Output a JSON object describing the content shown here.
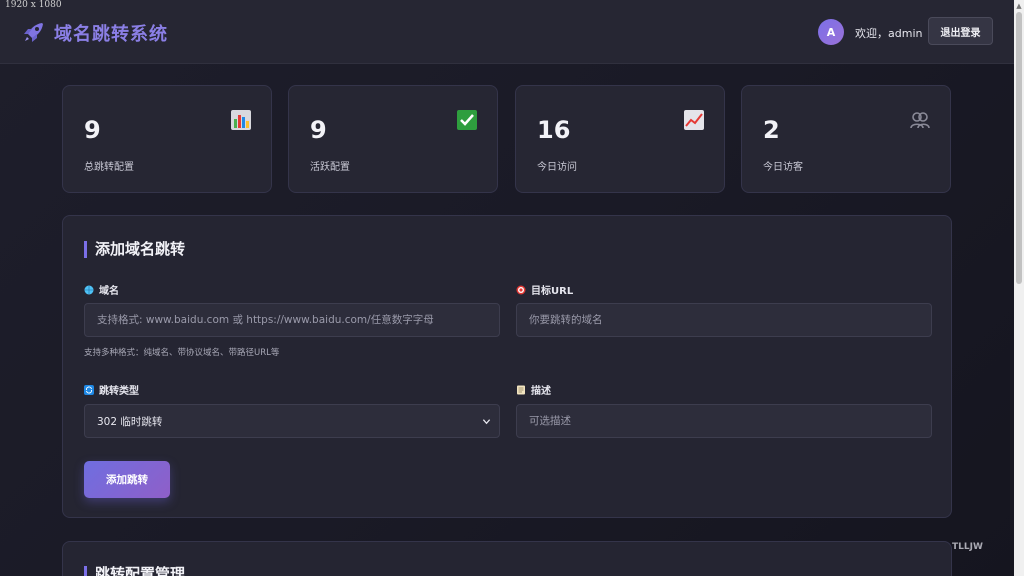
{
  "screen_label": "1920 x 1080",
  "header": {
    "brand": "域名跳转系统",
    "avatar_letter": "A",
    "welcome": "欢迎，admin",
    "logout_label": "退出登录"
  },
  "stats": [
    {
      "value": "9",
      "label": "总跳转配置",
      "icon": "bar-chart-icon"
    },
    {
      "value": "9",
      "label": "活跃配置",
      "icon": "check-mark-icon"
    },
    {
      "value": "16",
      "label": "今日访问",
      "icon": "trend-up-icon"
    },
    {
      "value": "2",
      "label": "今日访客",
      "icon": "users-icon"
    }
  ],
  "form": {
    "title": "添加域名跳转",
    "domain": {
      "label": "域名",
      "placeholder": "支持格式: www.baidu.com 或 https://www.baidu.com/任意数字字母",
      "hint": "支持多种格式：纯域名、带协议域名、带路径URL等"
    },
    "target": {
      "label": "目标URL",
      "placeholder": "你要跳转的域名"
    },
    "redirect_type": {
      "label": "跳转类型",
      "selected": "302 临时跳转"
    },
    "description": {
      "label": "描述",
      "placeholder": "可选描述"
    },
    "submit_label": "添加跳转"
  },
  "manage": {
    "title": "跳转配置管理"
  },
  "watermark": "TLLJW"
}
